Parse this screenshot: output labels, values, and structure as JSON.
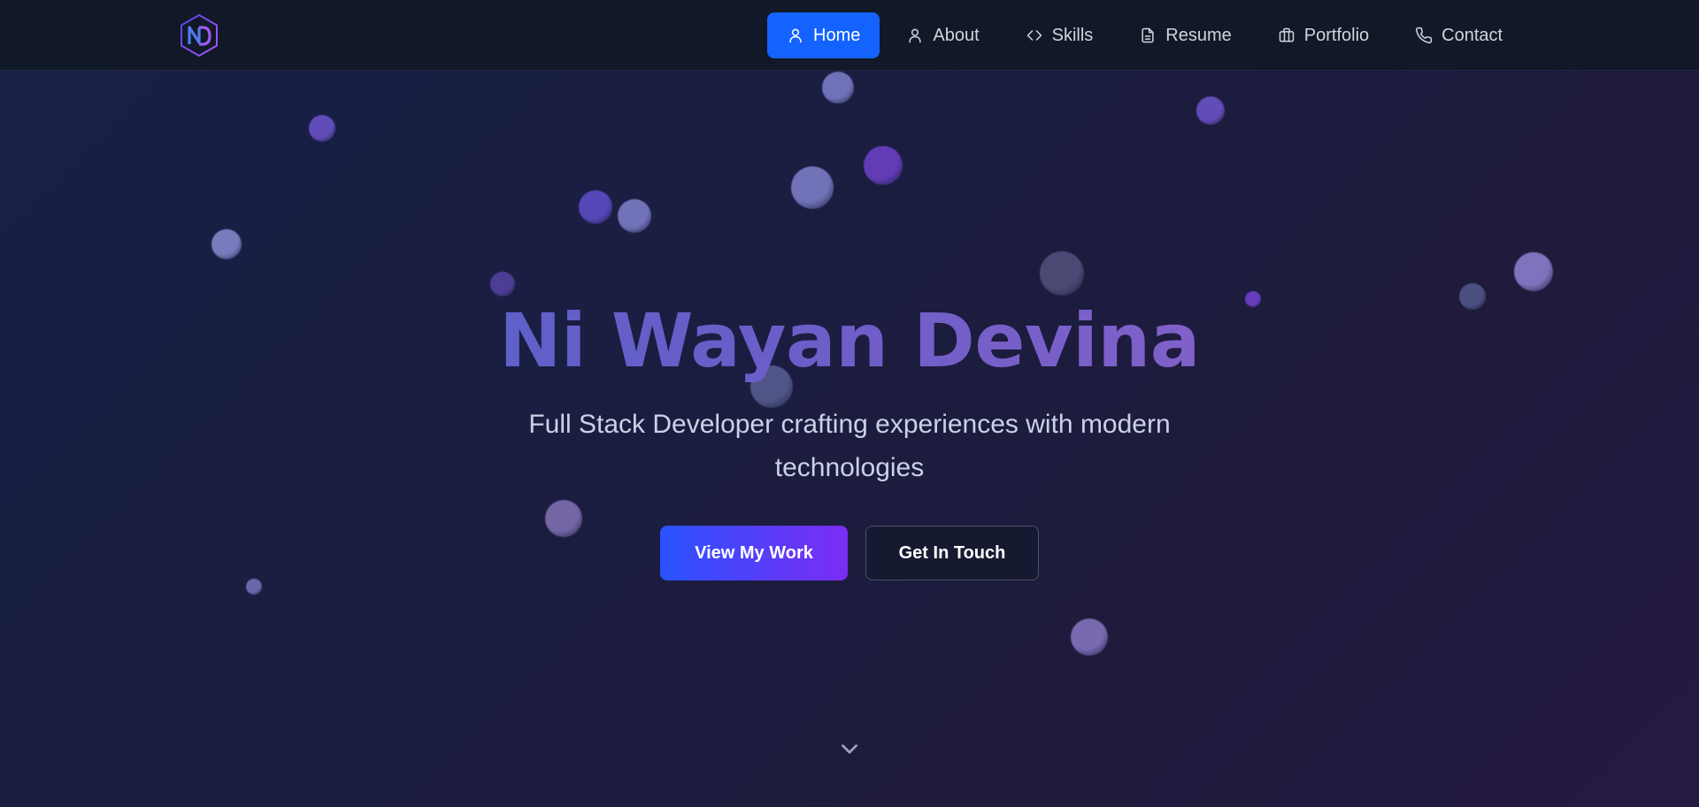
{
  "navbar": {
    "logo_text": "ND",
    "items": [
      {
        "label": "Home",
        "icon": "user-icon",
        "active": true
      },
      {
        "label": "About",
        "icon": "user-icon",
        "active": false
      },
      {
        "label": "Skills",
        "icon": "code-icon",
        "active": false
      },
      {
        "label": "Resume",
        "icon": "file-icon",
        "active": false
      },
      {
        "label": "Portfolio",
        "icon": "briefcase-icon",
        "active": false
      },
      {
        "label": "Contact",
        "icon": "phone-icon",
        "active": false
      }
    ]
  },
  "hero": {
    "title": "Ni Wayan Devina",
    "subtitle": "Full Stack Developer crafting experiences with modern technologies",
    "primary_button": "View My Work",
    "secondary_button": "Get In Touch",
    "scroll_icon": "chevron-down-icon"
  },
  "colors": {
    "nav_background": "#111827",
    "active_nav": "#1463ff",
    "gradient_start": "#2a53ff",
    "gradient_end": "#7c2cf4",
    "hero_background": "#1b1d40"
  }
}
